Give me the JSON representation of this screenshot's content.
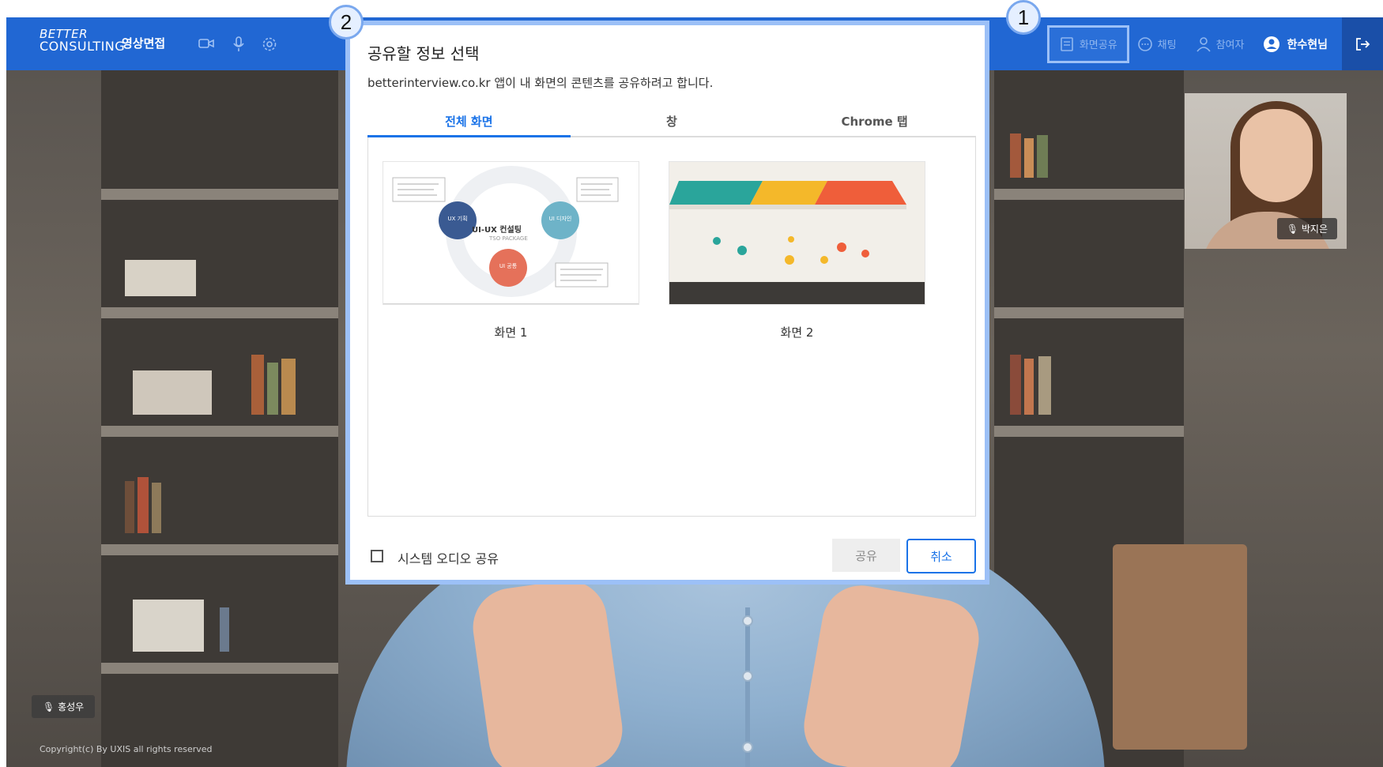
{
  "app": {
    "logo_line1": "BETTER",
    "logo_line2": "CONSULTING",
    "title": "영상면접"
  },
  "topbar": {
    "screen_share_label": "화면공유",
    "chat_label": "채팅",
    "participants_label": "참여자",
    "user_name": "한수현님"
  },
  "participants": {
    "side_tile_name": "박지은",
    "main_name": "홍성우"
  },
  "copyright": "Copyright(c) By UXIS all rights reserved",
  "callouts": {
    "one": "1",
    "two": "2"
  },
  "dialog": {
    "title": "공유할 정보 선택",
    "description": "betterinterview.co.kr 앱이 내 화면의 콘텐츠를 공유하려고 합니다.",
    "tabs": [
      {
        "label": "전체 화면",
        "active": true
      },
      {
        "label": "창",
        "active": false
      },
      {
        "label": "Chrome 탭",
        "active": false
      }
    ],
    "screens": [
      {
        "label": "화면 1"
      },
      {
        "label": "화면 2"
      }
    ],
    "thumb1": {
      "center_title": "UI-UX 컨설팅",
      "center_sub": "TSO PACKAGE",
      "node_ux": "UX 기획",
      "node_ui_design": "UI 디자인",
      "node_ui_common": "UI 공통"
    },
    "audio_checkbox_label": "시스템 오디오 공유",
    "share_button": "공유",
    "cancel_button": "취소"
  }
}
